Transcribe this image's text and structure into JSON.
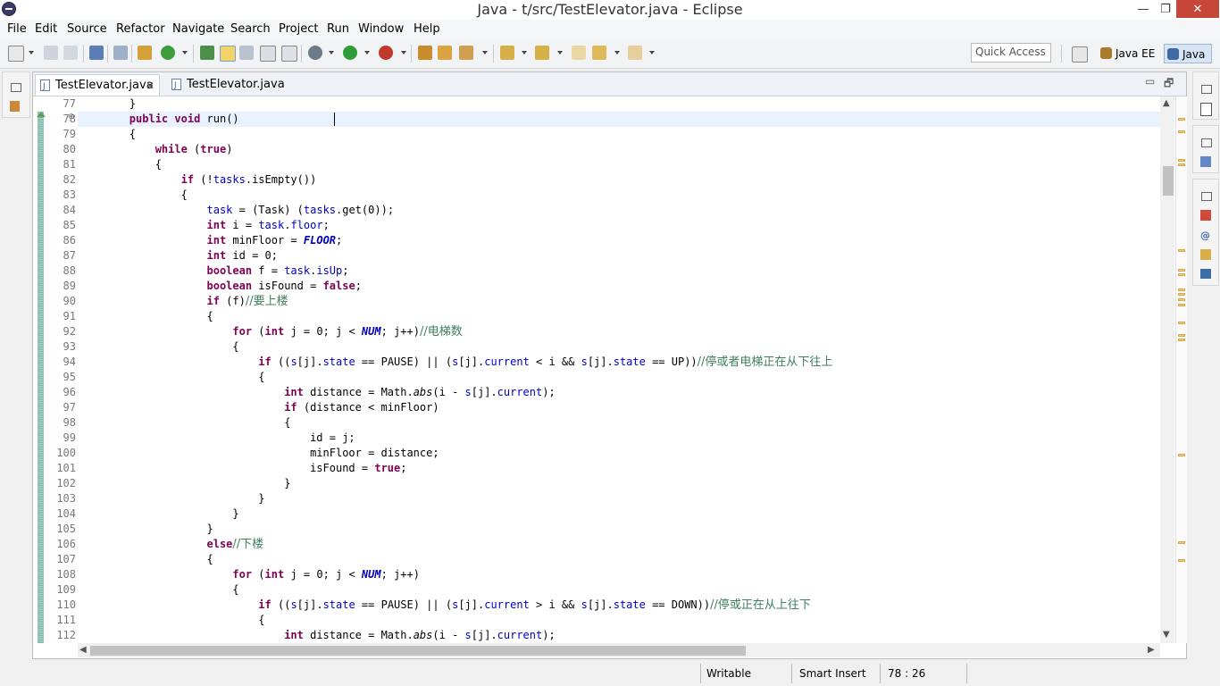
{
  "window": {
    "title": "Java - t/src/TestElevator.java - Eclipse",
    "minimize": "—",
    "maximize": "❐",
    "close": "✕"
  },
  "menu": [
    "File",
    "Edit",
    "Source",
    "Refactor",
    "Navigate",
    "Search",
    "Project",
    "Run",
    "Window",
    "Help"
  ],
  "toolbar": {
    "quick_access": "Quick Access",
    "perspectives": [
      "Java EE",
      "Java"
    ],
    "active_perspective": "Java"
  },
  "editor": {
    "tabs": [
      {
        "label": "TestElevator.java",
        "active": true,
        "close": "✕"
      },
      {
        "label": "TestElevator.java",
        "active": false
      }
    ],
    "minimize": "▭",
    "maximize": "🗗",
    "current_line": 78,
    "line_numbers": [
      "77",
      "78",
      "79",
      "80",
      "81",
      "82",
      "83",
      "84",
      "85",
      "86",
      "87",
      "88",
      "89",
      "90",
      "91",
      "92",
      "93",
      "94",
      "95",
      "96",
      "97",
      "98",
      "99",
      "100",
      "101",
      "102",
      "103",
      "104",
      "105",
      "106",
      "107",
      "108",
      "109",
      "110",
      "111",
      "112"
    ],
    "code": {
      "l77": "        }",
      "l78_a": "        ",
      "l78_kw1": "public",
      "l78_sp": " ",
      "l78_kw2": "void",
      "l78_b": " run()",
      "l79": "        {",
      "l80_a": "            ",
      "l80_kw": "while",
      "l80_b": " (",
      "l80_kw2": "true",
      "l80_c": ")",
      "l81": "            {",
      "l82_a": "                ",
      "l82_kw": "if",
      "l82_b": " (!",
      "l82_fd": "tasks",
      "l82_c": ".isEmpty())",
      "l83": "                {",
      "l84_a": "                    ",
      "l84_fd": "task",
      "l84_b": " = (Task) (",
      "l84_fd2": "tasks",
      "l84_c": ".get(0));",
      "l85_a": "                    ",
      "l85_kw": "int",
      "l85_b": " i = ",
      "l85_fd": "task",
      "l85_c": ".",
      "l85_fd2": "floor",
      "l85_d": ";",
      "l86_a": "                    ",
      "l86_kw": "int",
      "l86_b": " minFloor = ",
      "l86_st": "FLOOR",
      "l86_c": ";",
      "l87_a": "                    ",
      "l87_kw": "int",
      "l87_b": " id = 0;",
      "l88_a": "                    ",
      "l88_kw": "boolean",
      "l88_b": " f = ",
      "l88_fd": "task",
      "l88_c": ".",
      "l88_fd2": "isUp",
      "l88_d": ";",
      "l89_a": "                    ",
      "l89_kw": "boolean",
      "l89_b": " isFound = ",
      "l89_kw2": "false",
      "l89_c": ";",
      "l90_a": "                    ",
      "l90_kw": "if",
      "l90_b": " (f)",
      "l90_cm": "//要上楼",
      "l91": "                    {",
      "l92_a": "                        ",
      "l92_kw": "for",
      "l92_b": " (",
      "l92_kw2": "int",
      "l92_c": " j = 0; j < ",
      "l92_st": "NUM",
      "l92_d": "; j++)",
      "l92_cm": "//电梯数",
      "l93": "                        {",
      "l94_a": "                            ",
      "l94_kw": "if",
      "l94_b": " ((",
      "l94_fd": "s",
      "l94_c": "[j].",
      "l94_fd2": "state",
      "l94_d": " == PAUSE) || (",
      "l94_fd3": "s",
      "l94_e": "[j].",
      "l94_fd4": "current",
      "l94_f": " < i && ",
      "l94_fd5": "s",
      "l94_g": "[j].",
      "l94_fd6": "state",
      "l94_h": " == UP))",
      "l94_cm": "//停或者电梯正在从下往上",
      "l95": "                            {",
      "l96_a": "                                ",
      "l96_kw": "int",
      "l96_b": " distance = Math.",
      "l96_it": "abs",
      "l96_c": "(i - ",
      "l96_fd": "s",
      "l96_d": "[j].",
      "l96_fd2": "current",
      "l96_e": ");",
      "l97_a": "                                ",
      "l97_kw": "if",
      "l97_b": " (distance < minFloor)",
      "l98": "                                {",
      "l99": "                                    id = j;",
      "l100": "                                    minFloor = distance;",
      "l101_a": "                                    isFound = ",
      "l101_kw": "true",
      "l101_b": ";",
      "l102": "                                }",
      "l103": "                            }",
      "l104": "                        }",
      "l105": "                    }",
      "l106_a": "                    ",
      "l106_kw": "else",
      "l106_cm": "//下楼",
      "l107": "                    {",
      "l108_a": "                        ",
      "l108_kw": "for",
      "l108_b": " (",
      "l108_kw2": "int",
      "l108_c": " j = 0; j < ",
      "l108_st": "NUM",
      "l108_d": "; j++)",
      "l109": "                        {",
      "l110_a": "                            ",
      "l110_kw": "if",
      "l110_b": " ((",
      "l110_fd": "s",
      "l110_c": "[j].",
      "l110_fd2": "state",
      "l110_d": " == PAUSE) || (",
      "l110_fd3": "s",
      "l110_e": "[j].",
      "l110_fd4": "current",
      "l110_f": " > i && ",
      "l110_fd5": "s",
      "l110_g": "[j].",
      "l110_fd6": "state",
      "l110_h": " == DOWN))",
      "l110_cm": "//停或正在从上往下",
      "l111": "                            {",
      "l112_a": "                                ",
      "l112_kw": "int",
      "l112_b": " distance = Math.",
      "l112_it": "abs",
      "l112_c": "(i - ",
      "l112_fd": "s",
      "l112_d": "[j].",
      "l112_fd2": "current",
      "l112_e": ");"
    }
  },
  "scroll": {
    "up": "▲",
    "down": "▼",
    "left": "◀",
    "right": "▶"
  },
  "status": {
    "writable": "Writable",
    "insert_mode": "Smart Insert",
    "position": "78 : 26"
  },
  "colors": {
    "keyword": "#7f0055",
    "field": "#0000c0",
    "comment": "#3f7f5f",
    "current_line": "#e8f2fe",
    "close_button": "#c7463a"
  },
  "icons": [
    "eclipse-app-icon",
    "java-file-icon",
    "new-icon",
    "save-icon",
    "run-icon",
    "debug-icon",
    "search-icon",
    "perspective-icon"
  ]
}
